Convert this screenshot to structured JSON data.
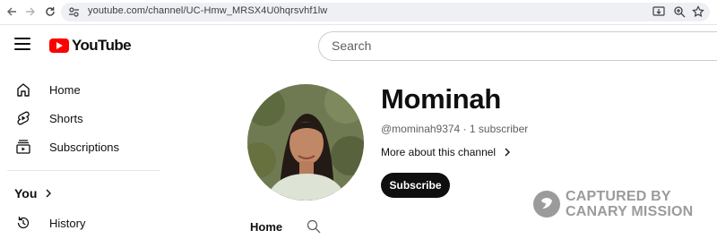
{
  "browser": {
    "url": "youtube.com/channel/UC-Hmw_MRSX4U0hqrsvhf1lw",
    "icons": [
      "back-arrow-icon",
      "forward-arrow-icon",
      "reload-icon",
      "site-info-icon",
      "install-app-icon",
      "zoom-icon",
      "bookmark-star-icon"
    ]
  },
  "header": {
    "logo_text": "YouTube",
    "search_placeholder": "Search",
    "brand_color": "#ff0000"
  },
  "sidebar": {
    "items": [
      {
        "label": "Home",
        "icon": "home-icon"
      },
      {
        "label": "Shorts",
        "icon": "shorts-icon"
      },
      {
        "label": "Subscriptions",
        "icon": "subscriptions-icon"
      }
    ],
    "you_label": "You",
    "history_label": "History"
  },
  "channel": {
    "name": "Mominah",
    "meta": "@mominah9374 · 1 subscriber",
    "more_about": "More about this channel",
    "subscribe_label": "Subscribe",
    "tabs": [
      "Home"
    ]
  },
  "watermark": {
    "line1": "CAPTURED BY",
    "line2": "CANARY MISSION"
  }
}
